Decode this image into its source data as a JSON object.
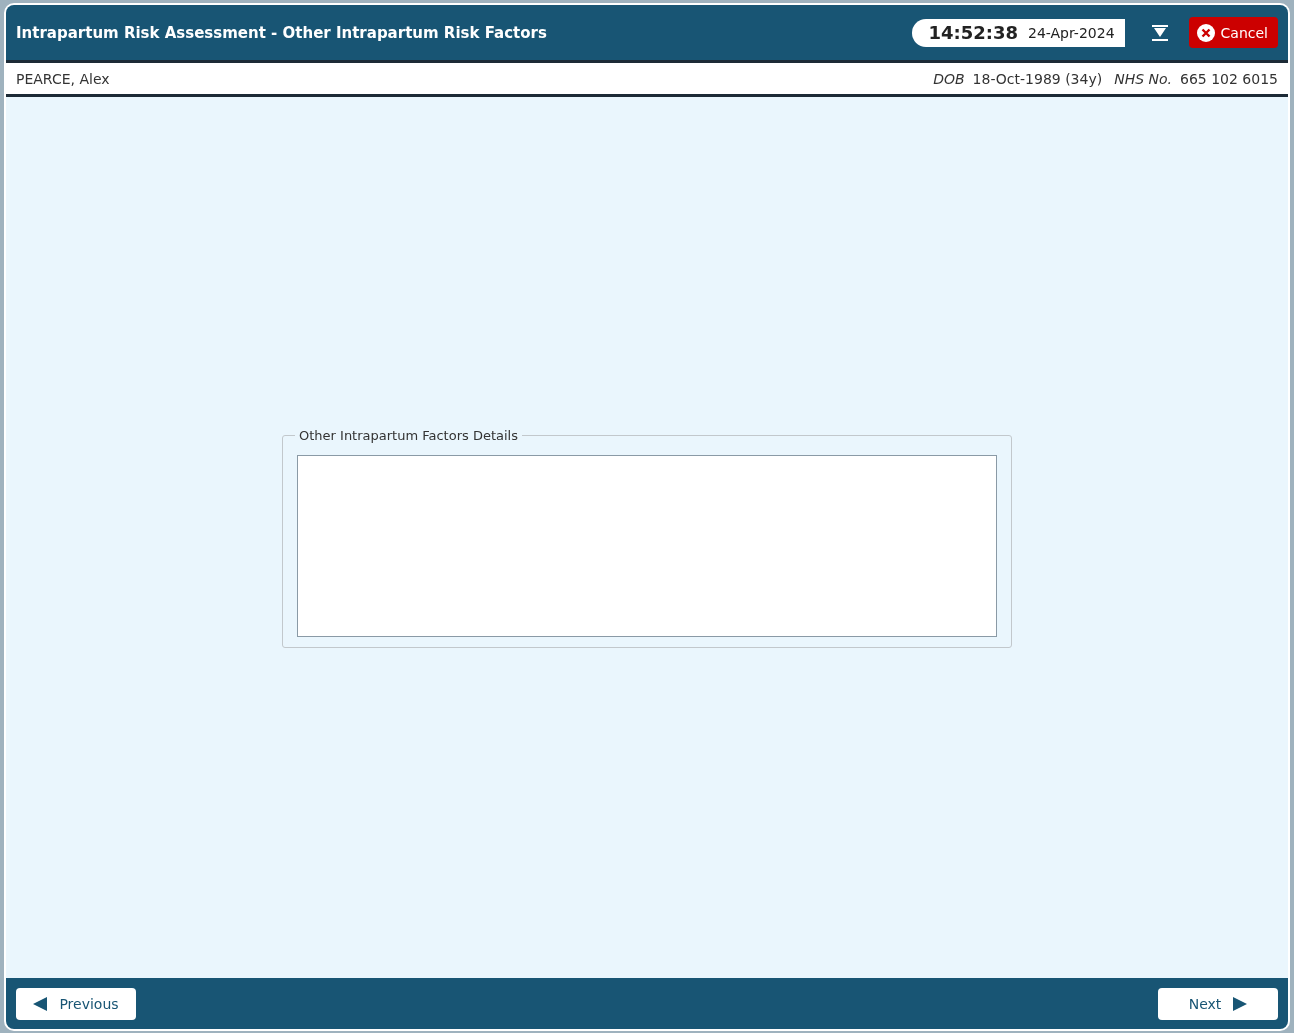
{
  "window": {
    "title": "Intrapartum Risk Assessment - Other Intrapartum Risk Factors"
  },
  "clock": {
    "time": "14:52:38",
    "date": "24-Apr-2024"
  },
  "cancel_button": {
    "label": "Cancel"
  },
  "patient": {
    "name": "PEARCE, Alex",
    "dob_label": "DOB",
    "dob": "18-Oct-1989 (34y)",
    "nhs_label": "NHS No.",
    "nhs": "665 102 6015"
  },
  "details_group": {
    "legend": "Other Intrapartum Factors Details"
  },
  "footer": {
    "previous": "Previous",
    "next": "Next"
  }
}
